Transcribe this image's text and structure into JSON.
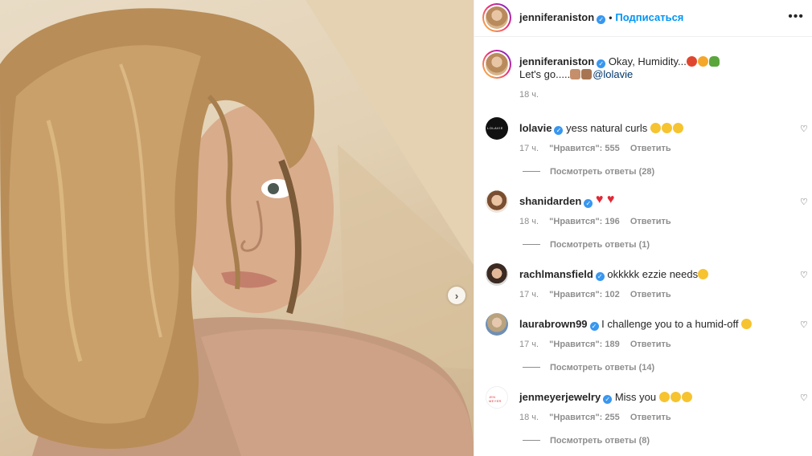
{
  "post": {
    "carousel_next": "›"
  },
  "header": {
    "username": "jenniferaniston",
    "verified": "✓",
    "dot": "•",
    "follow_label": "Подписаться",
    "more": "•••"
  },
  "caption": {
    "username": "jenniferaniston",
    "text_line1": "Okay, Humidity...",
    "text_line2": "Let's go.....",
    "mention": "@lolavie",
    "time": "18 ч."
  },
  "comments": [
    {
      "username": "lolavie",
      "text": "yess natural curls",
      "time": "17 ч.",
      "likes": "\"Нравится\": 555",
      "reply": "Ответить",
      "view_replies": "Посмотреть ответы (28)"
    },
    {
      "username": "shanidarden",
      "text": "",
      "time": "18 ч.",
      "likes": "\"Нравится\": 196",
      "reply": "Ответить",
      "view_replies": "Посмотреть ответы (1)"
    },
    {
      "username": "rachlmansfield",
      "text": "okkkkk ezzie needs",
      "time": "17 ч.",
      "likes": "\"Нравится\": 102",
      "reply": "Ответить"
    },
    {
      "username": "laurabrown99",
      "text": "I challenge you to a humid-off",
      "time": "17 ч.",
      "likes": "\"Нравится\": 189",
      "reply": "Ответить",
      "view_replies": "Посмотреть ответы (14)"
    },
    {
      "username": "jenmeyerjewelry",
      "text": "Miss you",
      "time": "18 ч.",
      "likes": "\"Нравится\": 255",
      "reply": "Ответить",
      "view_replies": "Посмотреть ответы (8)"
    }
  ],
  "icons": {
    "heart": "♡"
  },
  "colors": {
    "accent": "#0095f6",
    "verified": "#3897f0",
    "mention": "#00376b",
    "muted": "#8e8e8e"
  }
}
